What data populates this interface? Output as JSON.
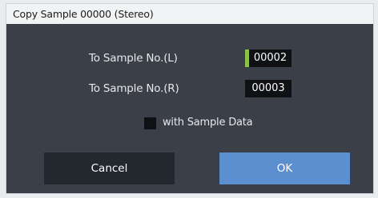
{
  "dialog": {
    "title": "Copy Sample 00000 (Stereo)",
    "to_sample_left_label": "To Sample No.(L)",
    "to_sample_left_value": "00002",
    "to_sample_right_label": "To Sample No.(R)",
    "to_sample_right_value": "00003",
    "with_sample_data_label": "with Sample Data",
    "with_sample_data_checked": false,
    "cancel_label": "Cancel",
    "ok_label": "OK"
  },
  "colors": {
    "dialog_background": "#3b4048",
    "title_background": "#f2f3f5",
    "field_background": "#0f1114",
    "selection_accent": "#8bc34a",
    "ok_button": "#5b8fcf",
    "cancel_button": "#23272e"
  }
}
